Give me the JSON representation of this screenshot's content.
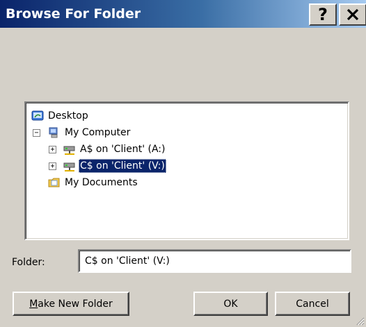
{
  "window": {
    "title": "Browse For Folder",
    "help_label": "?",
    "close_label": "✕"
  },
  "tree": {
    "items": [
      {
        "label": "Desktop",
        "icon": "desktop-icon"
      },
      {
        "label": "My Computer",
        "icon": "computer-icon",
        "expander": "−"
      },
      {
        "label": "A$ on 'Client' (A:)",
        "icon": "network-drive-icon",
        "expander": "+"
      },
      {
        "label": "C$ on 'Client' (V:)",
        "icon": "network-drive-icon",
        "expander": "+",
        "selected": true
      },
      {
        "label": "My Documents",
        "icon": "documents-folder-icon"
      }
    ]
  },
  "folder": {
    "label": "Folder:",
    "value": "C$ on 'Client' (V:)"
  },
  "buttons": {
    "make_new_folder_mnemonic": "M",
    "make_new_folder_rest": "ake New Folder",
    "ok": "OK",
    "cancel": "Cancel"
  },
  "colors": {
    "title_start": "#0a246a",
    "title_end": "#a6caf0",
    "selection": "#0a246a",
    "face": "#d4d0c8"
  }
}
